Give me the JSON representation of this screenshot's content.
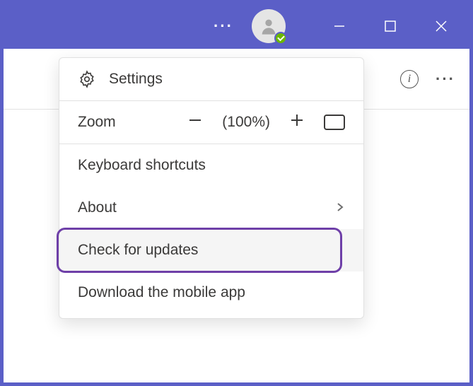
{
  "titlebar": {
    "ellipsis": "···"
  },
  "toolbar": {
    "info_glyph": "i",
    "ellipsis": "···"
  },
  "menu": {
    "settings": "Settings",
    "zoom_label": "Zoom",
    "zoom_value": "(100%)",
    "keyboard_shortcuts": "Keyboard shortcuts",
    "about": "About",
    "check_updates": "Check for updates",
    "download_mobile": "Download the mobile app"
  }
}
